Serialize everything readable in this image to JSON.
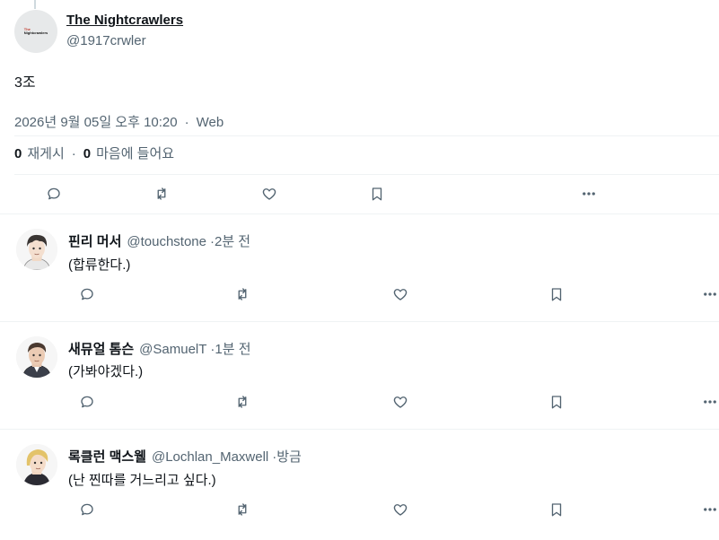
{
  "tweet": {
    "display_name": "The Nightcrawlers",
    "handle": "@1917crwler",
    "logo_text": "The Nightcrawlers",
    "text": "3조",
    "date": "2026년 9월 05일 오후 10:20",
    "separator": "·",
    "source": "Web",
    "retweet_count": "0",
    "retweet_label": "재게시",
    "like_count": "0",
    "like_label": "마음에 들어요"
  },
  "icons": [
    "reply-icon",
    "retweet-icon",
    "like-icon",
    "bookmark-icon",
    "more-icon"
  ],
  "colors": {
    "text": "#0f1419",
    "secondary": "#536471",
    "divider": "#eff3f4"
  },
  "replies": [
    {
      "name": "핀리 머서",
      "handle": "@touchstone",
      "time": "·2분 전",
      "text": "(합류한다.)"
    },
    {
      "name": "새뮤얼 톰슨",
      "handle": "@SamuelT",
      "time": "·1분 전",
      "text": "(가봐야겠다.)"
    },
    {
      "name": "록클런 맥스웰",
      "handle": "@Lochlan_Maxwell",
      "time": "·방금",
      "text": "(난 찐따를 거느리고 싶다.)"
    }
  ]
}
